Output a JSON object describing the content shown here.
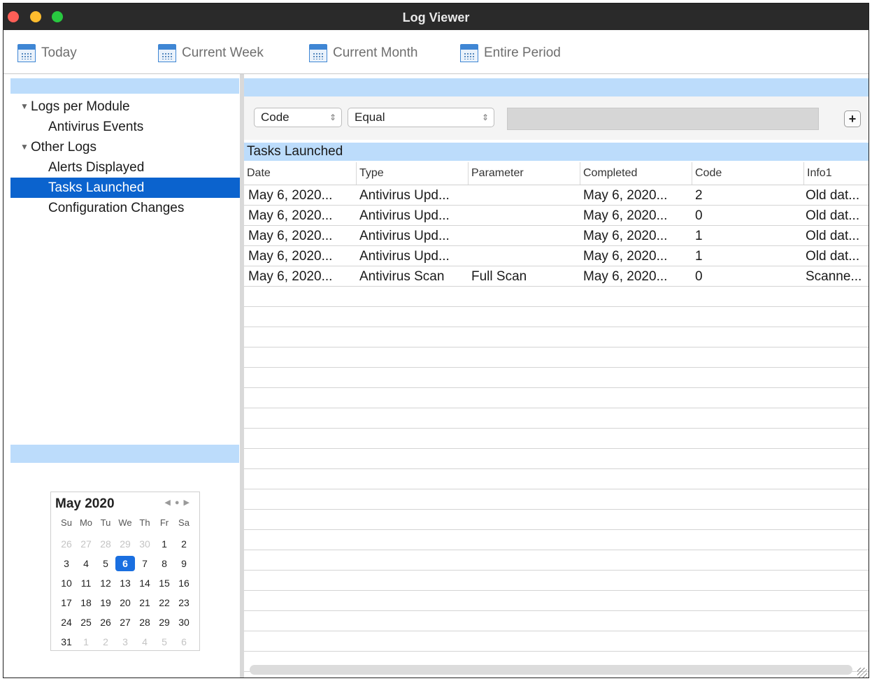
{
  "window": {
    "title": "Log Viewer"
  },
  "toolbar": {
    "buttons": [
      {
        "label": "Today",
        "icon": "calendar-icon"
      },
      {
        "label": "Current Week",
        "icon": "calendar-icon"
      },
      {
        "label": "Current Month",
        "icon": "calendar-icon"
      },
      {
        "label": "Entire Period",
        "icon": "calendar-icon"
      }
    ]
  },
  "sidebar": {
    "tree": [
      {
        "label": "Logs per Module",
        "type": "group",
        "expanded": true
      },
      {
        "label": "Antivirus Events",
        "type": "item"
      },
      {
        "label": "Other Logs",
        "type": "group",
        "expanded": true
      },
      {
        "label": "Alerts Displayed",
        "type": "item"
      },
      {
        "label": "Tasks Launched",
        "type": "item",
        "selected": true
      },
      {
        "label": "Configuration Changes",
        "type": "item"
      }
    ],
    "calendar": {
      "month": "May 2020",
      "weekdays": [
        "Su",
        "Mo",
        "Tu",
        "We",
        "Th",
        "Fr",
        "Sa"
      ],
      "weeks": [
        [
          "26",
          "27",
          "28",
          "29",
          "30",
          "1",
          "2"
        ],
        [
          "3",
          "4",
          "5",
          "6",
          "7",
          "8",
          "9"
        ],
        [
          "10",
          "11",
          "12",
          "13",
          "14",
          "15",
          "16"
        ],
        [
          "17",
          "18",
          "19",
          "20",
          "21",
          "22",
          "23"
        ],
        [
          "24",
          "25",
          "26",
          "27",
          "28",
          "29",
          "30"
        ],
        [
          "31",
          "1",
          "2",
          "3",
          "4",
          "5",
          "6"
        ]
      ],
      "selected": "6"
    }
  },
  "filter": {
    "field": "Code",
    "operator": "Equal",
    "value": "",
    "add_label": "+"
  },
  "table": {
    "title": "Tasks Launched",
    "columns": [
      "Date",
      "Type",
      "Parameter",
      "Completed",
      "Code",
      "Info1"
    ],
    "rows": [
      [
        "May 6, 2020...",
        "Antivirus Upd...",
        "",
        "May 6, 2020...",
        "2",
        "Old dat..."
      ],
      [
        "May 6, 2020...",
        "Antivirus Upd...",
        "",
        "May 6, 2020...",
        "0",
        "Old dat..."
      ],
      [
        "May 6, 2020...",
        "Antivirus Upd...",
        "",
        "May 6, 2020...",
        "1",
        "Old dat..."
      ],
      [
        "May 6, 2020...",
        "Antivirus Upd...",
        "",
        "May 6, 2020...",
        "1",
        "Old dat..."
      ],
      [
        "May 6, 2020...",
        "Antivirus Scan",
        "Full Scan",
        "May 6, 2020...",
        "0",
        "Scanne..."
      ]
    ]
  },
  "colors": {
    "selection": "#0b63ce",
    "header_band": "#bcdcfb",
    "calendar_selected": "#1a6fe0"
  }
}
